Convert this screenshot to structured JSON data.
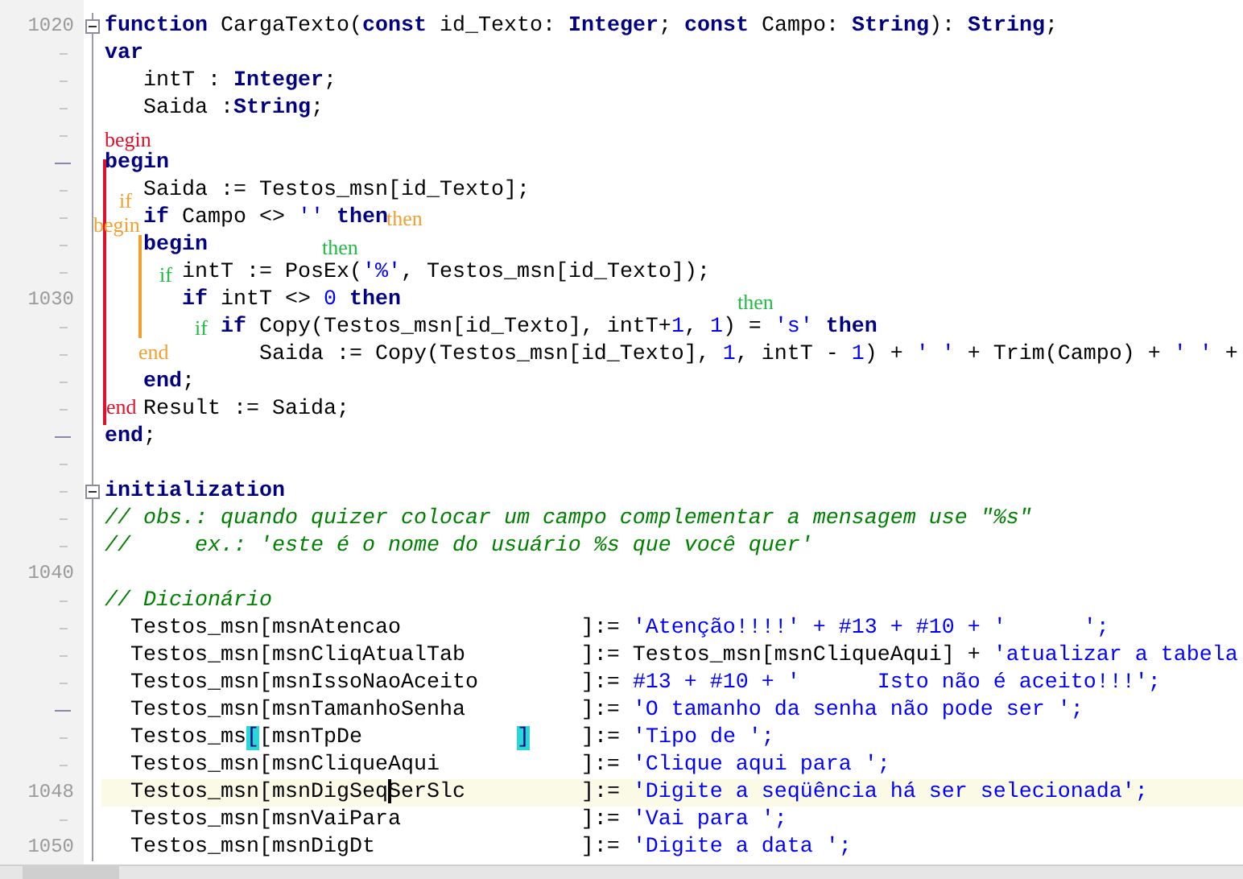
{
  "editor": {
    "lines": [
      {
        "number": "1020",
        "fold": true,
        "current": false,
        "tokens": [
          {
            "kind": "kw",
            "text": "function"
          },
          {
            "kind": "p",
            "text": " CargaTexto("
          },
          {
            "kind": "kw",
            "text": "const"
          },
          {
            "kind": "p",
            "text": " id_Texto: "
          },
          {
            "kind": "kw",
            "text": "Integer"
          },
          {
            "kind": "p",
            "text": "; "
          },
          {
            "kind": "kw",
            "text": "const"
          },
          {
            "kind": "p",
            "text": " Campo: "
          },
          {
            "kind": "kw",
            "text": "String"
          },
          {
            "kind": "p",
            "text": "): "
          },
          {
            "kind": "kw",
            "text": "String"
          },
          {
            "kind": "p",
            "text": ";"
          }
        ]
      },
      {
        "kind": "short",
        "fold": false,
        "current": false,
        "tokens": [
          {
            "kind": "kw",
            "text": "var"
          }
        ]
      },
      {
        "kind": "short",
        "fold": false,
        "current": false,
        "tokens": [
          {
            "kind": "p",
            "text": "   intT : "
          },
          {
            "kind": "kw",
            "text": "Integer"
          },
          {
            "kind": "p",
            "text": ";"
          }
        ]
      },
      {
        "kind": "short",
        "fold": false,
        "current": false,
        "tokens": [
          {
            "kind": "p",
            "text": "   Saida :"
          },
          {
            "kind": "kw",
            "text": "String"
          },
          {
            "kind": "p",
            "text": ";"
          }
        ]
      },
      {
        "kind": "short",
        "fold": false,
        "current": false
      },
      {
        "kind": "long",
        "fold": false,
        "current": false,
        "tokens": [
          {
            "kind": "kw",
            "text": "begin"
          }
        ]
      },
      {
        "kind": "short",
        "fold": false,
        "current": false,
        "tokens": [
          {
            "kind": "p",
            "text": "   Saida := Testos_msn[id_Texto];"
          }
        ]
      },
      {
        "kind": "short",
        "fold": false,
        "current": false,
        "tokens": [
          {
            "kind": "kw",
            "text": "   if"
          },
          {
            "kind": "p",
            "text": " Campo <> "
          },
          {
            "kind": "s",
            "text": "''"
          },
          {
            "kind": "kw",
            "text": " then"
          }
        ]
      },
      {
        "kind": "short",
        "fold": false,
        "current": false,
        "tokens": [
          {
            "kind": "kw",
            "text": "   begin"
          }
        ]
      },
      {
        "kind": "short",
        "fold": false,
        "current": false,
        "tokens": [
          {
            "kind": "p",
            "text": "      intT := PosEx("
          },
          {
            "kind": "s",
            "text": "'%'"
          },
          {
            "kind": "p",
            "text": ", Testos_msn[id_Texto]);"
          }
        ]
      },
      {
        "number": "1030",
        "fold": false,
        "current": false,
        "tokens": [
          {
            "kind": "kw",
            "text": "      if"
          },
          {
            "kind": "p",
            "text": " intT <> "
          },
          {
            "kind": "s",
            "text": "0"
          },
          {
            "kind": "kw",
            "text": " then"
          }
        ]
      },
      {
        "kind": "short",
        "fold": false,
        "current": false,
        "tokens": [
          {
            "kind": "kw",
            "text": "         if"
          },
          {
            "kind": "p",
            "text": " Copy(Testos_msn[id_Texto], intT+"
          },
          {
            "kind": "s",
            "text": "1"
          },
          {
            "kind": "p",
            "text": ", "
          },
          {
            "kind": "s",
            "text": "1"
          },
          {
            "kind": "p",
            "text": ") = "
          },
          {
            "kind": "s",
            "text": "'s'"
          },
          {
            "kind": "kw",
            "text": " then"
          }
        ]
      },
      {
        "kind": "short",
        "fold": false,
        "current": false,
        "tokens": [
          {
            "kind": "p",
            "text": "            Saida := Copy(Testos_msn[id_Texto], "
          },
          {
            "kind": "s",
            "text": "1"
          },
          {
            "kind": "p",
            "text": ", intT - "
          },
          {
            "kind": "s",
            "text": "1"
          },
          {
            "kind": "p",
            "text": ") + "
          },
          {
            "kind": "s",
            "text": "' '"
          },
          {
            "kind": "p",
            "text": " + Trim(Campo) + "
          },
          {
            "kind": "s",
            "text": "' '"
          },
          {
            "kind": "p",
            "text": " +"
          }
        ]
      },
      {
        "kind": "short",
        "fold": false,
        "current": false,
        "tokens": [
          {
            "kind": "kw",
            "text": "   end"
          },
          {
            "kind": "p",
            "text": ";"
          }
        ]
      },
      {
        "kind": "short",
        "fold": false,
        "current": false,
        "tokens": [
          {
            "kind": "p",
            "text": "   Result := Saida;"
          }
        ]
      },
      {
        "kind": "long",
        "fold": false,
        "current": false,
        "tokens": [
          {
            "kind": "kw",
            "text": "end"
          },
          {
            "kind": "p",
            "text": ";"
          }
        ]
      },
      {
        "kind": "short",
        "fold": false,
        "current": false
      },
      {
        "kind": "short",
        "fold": true,
        "current": false,
        "tokens": [
          {
            "kind": "kw",
            "text": "initialization"
          }
        ]
      },
      {
        "kind": "short",
        "fold": false,
        "current": false,
        "tokens": [
          {
            "kind": "c",
            "text": "// obs.: quando quizer colocar um campo complementar a mensagem use \"%s\""
          }
        ]
      },
      {
        "kind": "short",
        "fold": false,
        "current": false,
        "tokens": [
          {
            "kind": "c",
            "text": "//     ex.: 'este é o nome do usuário %s que você quer'"
          }
        ]
      },
      {
        "number": "1040",
        "fold": false,
        "current": false
      },
      {
        "kind": "short",
        "fold": false,
        "current": false,
        "tokens": [
          {
            "kind": "c",
            "text": "// Dicionário"
          }
        ]
      },
      {
        "kind": "short",
        "fold": false,
        "current": false,
        "tokens": [
          {
            "kind": "p",
            "text": "  Testos_msn[msnAtencao              ]:= "
          },
          {
            "kind": "s",
            "text": "'Atenção!!!!' + #13 + #10 + '      ';"
          }
        ]
      },
      {
        "kind": "short",
        "fold": false,
        "current": false,
        "tokens": [
          {
            "kind": "p",
            "text": "  Testos_msn[msnCliqAtualTab         ]:= Testos_msn[msnCliqueAqui] + "
          },
          {
            "kind": "s",
            "text": "'atualizar a tabela"
          }
        ]
      },
      {
        "kind": "short",
        "fold": false,
        "current": false,
        "tokens": [
          {
            "kind": "p",
            "text": "  Testos_msn[msnIssoNaoAceito        ]:= "
          },
          {
            "kind": "s",
            "text": "#13 + #10 + '      Isto não é aceito!!!';"
          }
        ]
      },
      {
        "kind": "long",
        "fold": false,
        "current": false,
        "tokens": [
          {
            "kind": "p",
            "text": "  Testos_msn[msnTamanhoSenha         ]:= "
          },
          {
            "kind": "s",
            "text": "'O tamanho da senha não pode ser ';"
          }
        ]
      },
      {
        "kind": "short",
        "fold": false,
        "current": false,
        "tokens": [
          {
            "kind": "p",
            "text": "  Testos_ms"
          },
          {
            "kind": "bracket",
            "text": "["
          },
          {
            "kind": "p",
            "text": "[msnTpDe            "
          },
          {
            "kind": "bracket",
            "text": "]"
          },
          {
            "kind": "p",
            "text": "    ]:= "
          },
          {
            "kind": "s",
            "text": "'Tipo de ';"
          }
        ]
      },
      {
        "kind": "short",
        "fold": false,
        "current": false,
        "tokens": [
          {
            "kind": "p",
            "text": "  Testos_msn[msnCliqueAqui           ]:= "
          },
          {
            "kind": "s",
            "text": "'Clique aqui para ';"
          }
        ]
      },
      {
        "number": "1048",
        "fold": false,
        "current": true,
        "tokens": [
          {
            "kind": "p",
            "text": "  Testos_msn[msnDigSeq"
          },
          {
            "kind": "caret"
          },
          {
            "kind": "p",
            "text": "SerSlc         ]:= "
          },
          {
            "kind": "s",
            "text": "'Digite a seqüência há ser selecionada';"
          }
        ]
      },
      {
        "kind": "short",
        "fold": false,
        "current": false,
        "tokens": [
          {
            "kind": "p",
            "text": "  Testos_msn[msnVaiPara              ]:= "
          },
          {
            "kind": "s",
            "text": "'Vai para ';"
          }
        ]
      },
      {
        "number": "1050",
        "fold": false,
        "current": false,
        "tokens": [
          {
            "kind": "p",
            "text": "  Testos_msn[msnDigDt                ]:= "
          },
          {
            "kind": "s",
            "text": "'Digite a data ';"
          }
        ]
      }
    ],
    "structure_labels": [
      {
        "text": "begin",
        "color": "#e0102a"
      },
      {
        "text": "if",
        "color": "#f0a030"
      },
      {
        "text": "then",
        "color": "#f0a030"
      },
      {
        "text": "begin",
        "color": "#f0a030"
      },
      {
        "text": "if",
        "color": "#22bb44"
      },
      {
        "text": "then",
        "color": "#22bb44"
      },
      {
        "text": "if",
        "color": "#22bb44"
      },
      {
        "text": "then",
        "color": "#22bb44"
      },
      {
        "text": "end",
        "color": "#f0a030"
      },
      {
        "text": "end",
        "color": "#e0102a"
      }
    ]
  }
}
